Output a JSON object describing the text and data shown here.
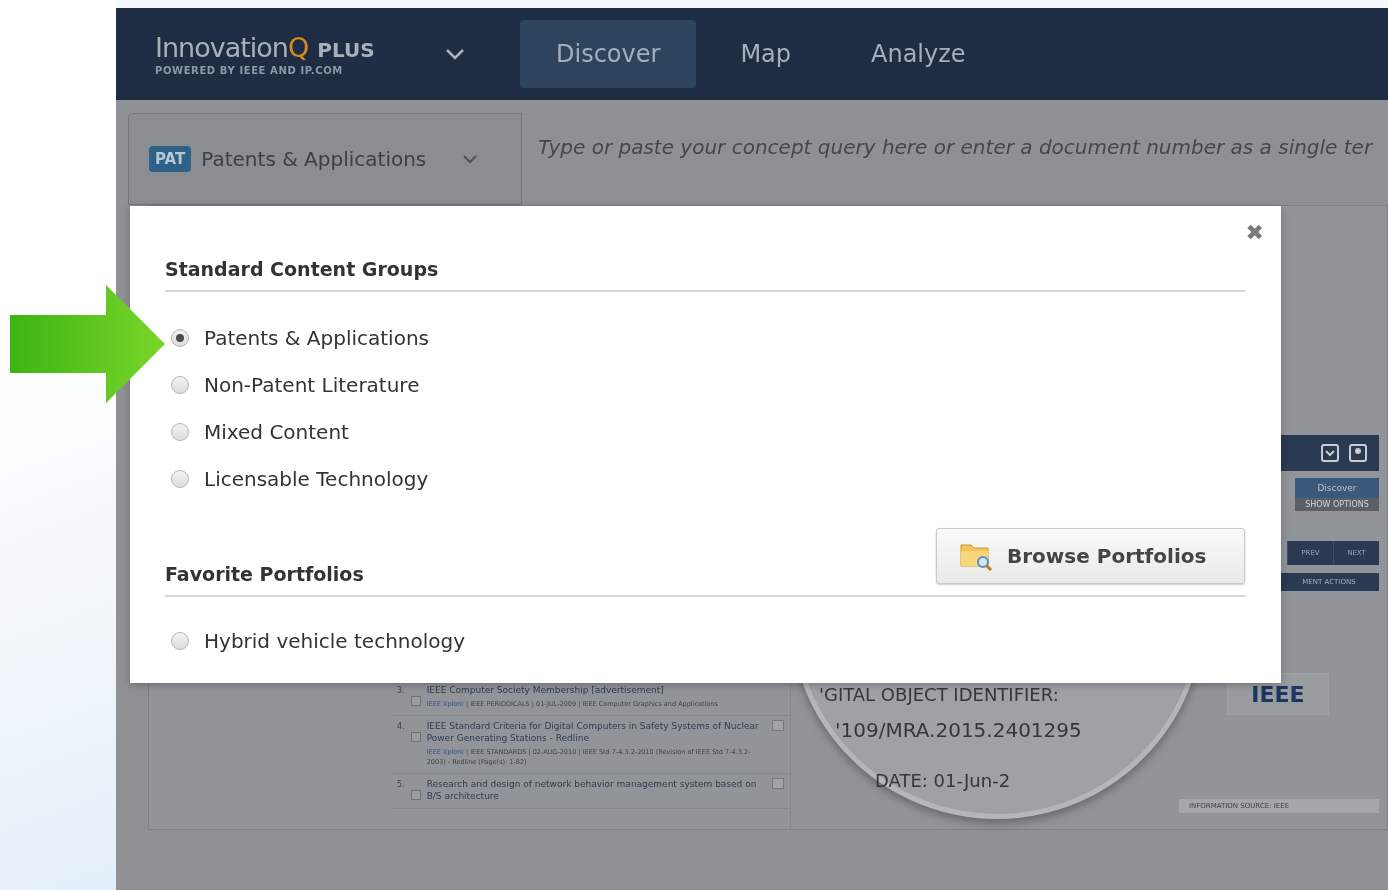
{
  "header": {
    "logo": {
      "name": "Innovation",
      "mark": "Q",
      "suffix": "PLUS",
      "tagline": "POWERED BY IEEE AND IP.COM"
    },
    "nav": [
      {
        "label": "Discover",
        "selected": true
      },
      {
        "label": "Map",
        "selected": false
      },
      {
        "label": "Analyze",
        "selected": false
      }
    ]
  },
  "search": {
    "collection_badge": "PAT",
    "collection": "Patents & Applications",
    "placeholder": "Type or paste your concept query here or enter a document number as a single ter"
  },
  "background": {
    "results": [
      {
        "number": "3.",
        "checked": false,
        "title": "IEEE Computer Society Membership [advertisement]",
        "source": "IEEE Xplore",
        "meta": "| IEEE PERIODICALS | 01-JUL-2009 | IEEE Computer Graphics and Applications"
      },
      {
        "number": "4.",
        "checked": false,
        "title": "IEEE Standard Criteria for Digital Computers in Safety Systems of Nuclear Power Generating Stations - Redline",
        "source": "IEEE Xplore",
        "meta": "| IEEE STANDARDS | 02-AUG-2010 | IEEE Std 7-4.3.2-2010 (Revision of IEEE Std 7-4.3.2-2003) - Redline (Page(s): 1-82)"
      },
      {
        "number": "5.",
        "checked": false,
        "title": "Research and design of network behavior management system based on B/S architecture"
      }
    ],
    "toolbar": {
      "discover": "Discover",
      "options": "SHOW OPTIONS",
      "prev": "PREV",
      "next": "NEXT",
      "actions": "MENT ACTIONS"
    },
    "magnifier": [
      "'GITAL OBJECT IDENTIFIER:",
      "'109/MRA.2015.2401295",
      "DATE: 01-Jun-2"
    ],
    "publisher_logo": "IEEE",
    "info_source": "INFORMATION SOURCE: IEEE"
  },
  "modal": {
    "close": "✖",
    "sections": [
      {
        "title": "Standard Content Groups",
        "options": [
          {
            "label": "Patents & Applications",
            "selected": true
          },
          {
            "label": "Non-Patent Literature",
            "selected": false
          },
          {
            "label": "Mixed Content",
            "selected": false
          },
          {
            "label": "Licensable Technology",
            "selected": false
          }
        ]
      },
      {
        "title": "Favorite Portfolios",
        "button": "Browse Portfolios",
        "options": [
          {
            "label": "Hybrid vehicle technology",
            "selected": false
          }
        ]
      }
    ]
  }
}
